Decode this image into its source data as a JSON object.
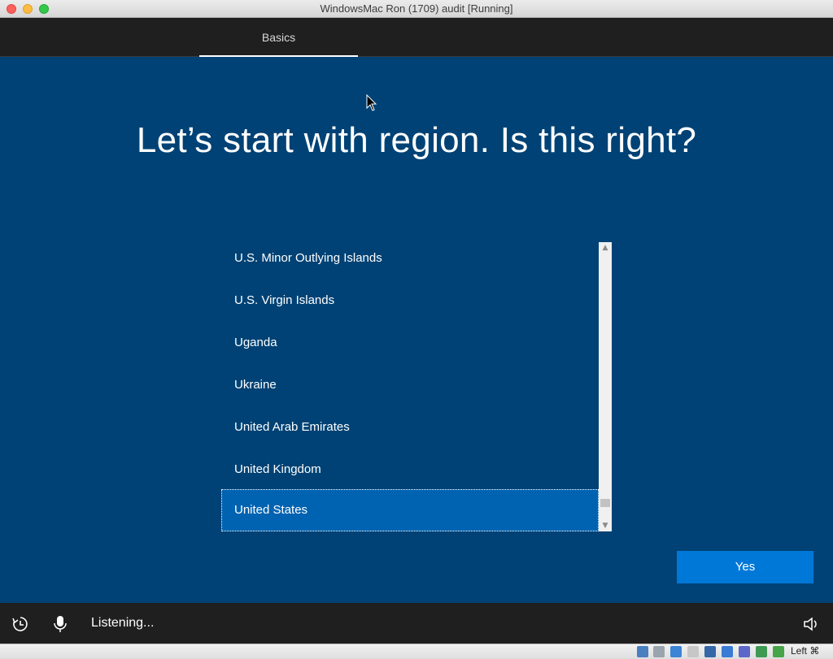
{
  "window": {
    "title": "WindowsMac Ron (1709) audit [Running]"
  },
  "topnav": {
    "tab_label": "Basics"
  },
  "main": {
    "heading": "Let’s start with region. Is this right?",
    "regions": [
      "U.S. Minor Outlying Islands",
      "U.S. Virgin Islands",
      "Uganda",
      "Ukraine",
      "United Arab Emirates",
      "United Kingdom",
      "United States"
    ],
    "selected_region": "United States",
    "yes_label": "Yes"
  },
  "bottombar": {
    "status": "Listening..."
  },
  "statusbar": {
    "host_key": "Left ⌘"
  },
  "colors": {
    "background": "#004275",
    "selected": "#0063b1",
    "button": "#0078d7",
    "bar": "#1f1f1f"
  },
  "icons": {
    "ease_of_access": "ease-of-access-icon",
    "microphone": "microphone-icon",
    "volume": "volume-icon"
  }
}
